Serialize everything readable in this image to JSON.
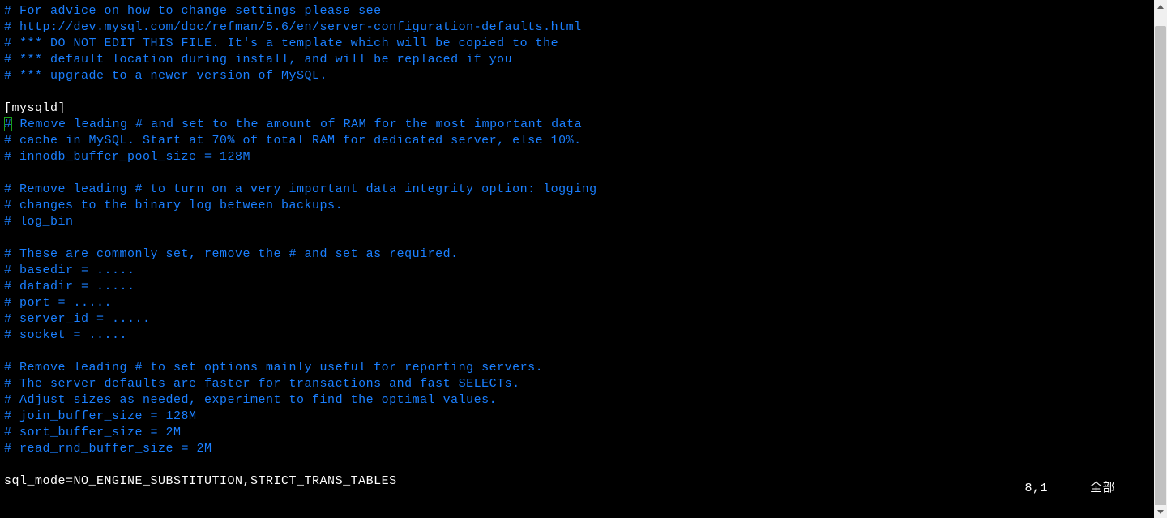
{
  "editor": {
    "lines": [
      {
        "kind": "comment",
        "text": "# For advice on how to change settings please see"
      },
      {
        "kind": "comment",
        "text": "# http://dev.mysql.com/doc/refman/5.6/en/server-configuration-defaults.html"
      },
      {
        "kind": "comment",
        "text": "# *** DO NOT EDIT THIS FILE. It's a template which will be copied to the"
      },
      {
        "kind": "comment",
        "text": "# *** default location during install, and will be replaced if you"
      },
      {
        "kind": "comment",
        "text": "# *** upgrade to a newer version of MySQL."
      },
      {
        "kind": "blank",
        "text": ""
      },
      {
        "kind": "section",
        "text": "[mysqld]"
      },
      {
        "kind": "cursor-comment",
        "cursor": "#",
        "rest": " Remove leading # and set to the amount of RAM for the most important data"
      },
      {
        "kind": "comment",
        "text": "# cache in MySQL. Start at 70% of total RAM for dedicated server, else 10%."
      },
      {
        "kind": "comment",
        "text": "# innodb_buffer_pool_size = 128M"
      },
      {
        "kind": "blank",
        "text": ""
      },
      {
        "kind": "comment",
        "text": "# Remove leading # to turn on a very important data integrity option: logging"
      },
      {
        "kind": "comment",
        "text": "# changes to the binary log between backups."
      },
      {
        "kind": "comment",
        "text": "# log_bin"
      },
      {
        "kind": "blank",
        "text": ""
      },
      {
        "kind": "comment",
        "text": "# These are commonly set, remove the # and set as required."
      },
      {
        "kind": "comment",
        "text": "# basedir = ....."
      },
      {
        "kind": "comment",
        "text": "# datadir = ....."
      },
      {
        "kind": "comment",
        "text": "# port = ....."
      },
      {
        "kind": "comment",
        "text": "# server_id = ....."
      },
      {
        "kind": "comment",
        "text": "# socket = ....."
      },
      {
        "kind": "blank",
        "text": ""
      },
      {
        "kind": "comment",
        "text": "# Remove leading # to set options mainly useful for reporting servers."
      },
      {
        "kind": "comment",
        "text": "# The server defaults are faster for transactions and fast SELECTs."
      },
      {
        "kind": "comment",
        "text": "# Adjust sizes as needed, experiment to find the optimal values."
      },
      {
        "kind": "comment",
        "text": "# join_buffer_size = 128M"
      },
      {
        "kind": "comment",
        "text": "# sort_buffer_size = 2M"
      },
      {
        "kind": "comment",
        "text": "# read_rnd_buffer_size = 2M"
      },
      {
        "kind": "blank",
        "text": ""
      },
      {
        "kind": "plain",
        "text": "sql_mode=NO_ENGINE_SUBSTITUTION,STRICT_TRANS_TABLES"
      }
    ]
  },
  "status": {
    "position": "8,1",
    "label": "全部"
  }
}
